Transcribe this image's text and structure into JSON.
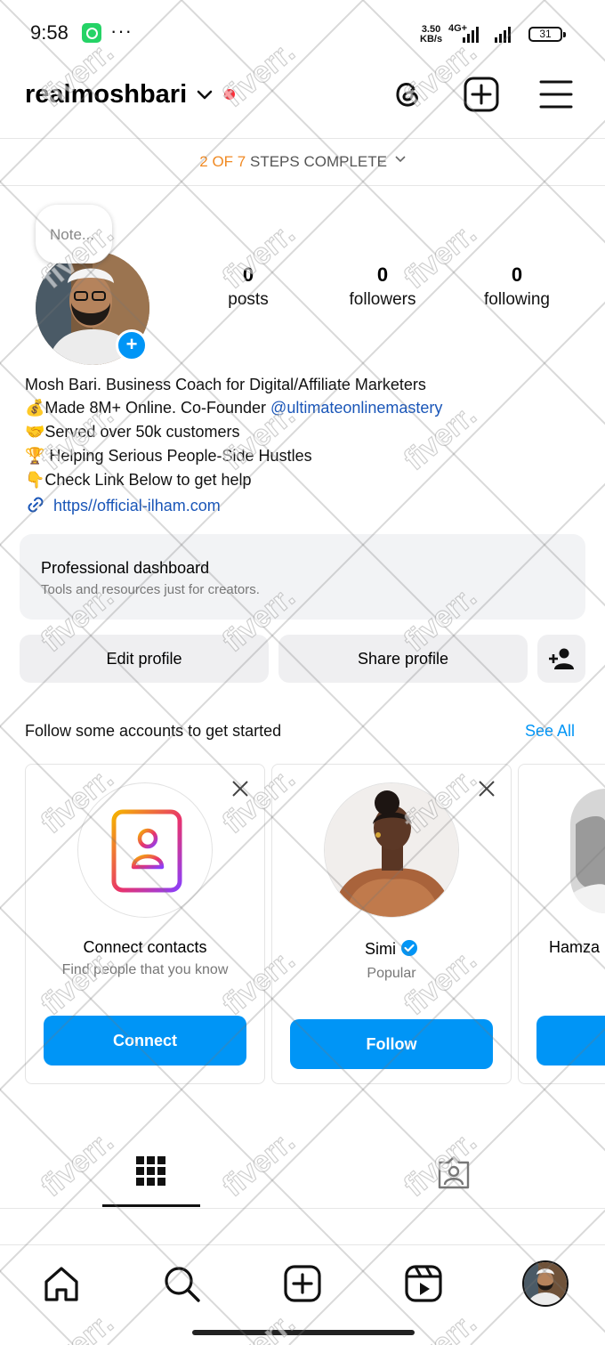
{
  "status_bar": {
    "time": "9:58",
    "more": "···",
    "speed_value": "3.50",
    "speed_unit": "KB/s",
    "network_type": "4G+",
    "battery": "31"
  },
  "header": {
    "username": "realmoshbari"
  },
  "onboarding": {
    "steps_done": "2 OF 7",
    "steps_text": "STEPS COMPLETE"
  },
  "profile": {
    "note_placeholder": "Note...",
    "posts_count": "0",
    "posts_label": "posts",
    "followers_count": "0",
    "followers_label": "followers",
    "following_count": "0",
    "following_label": "following"
  },
  "bio": {
    "line1": "Mosh Bari. Business Coach for Digital/Affiliate Marketers",
    "line2_prefix": "💰Made 8M+ Online. Co-Founder ",
    "line2_mention": "@ultimateonlinemastery",
    "line3": "🤝Served over 50k customers",
    "line4": "🏆 Helping Serious People-Side Hustles",
    "line5": "👇Check Link Below to get help",
    "link": "https//official-ilham.com"
  },
  "dashboard": {
    "title": "Professional dashboard",
    "subtitle": "Tools and resources just for creators."
  },
  "actions": {
    "edit_profile": "Edit profile",
    "share_profile": "Share profile"
  },
  "suggestions": {
    "title": "Follow some accounts to get started",
    "see_all": "See All",
    "cards": [
      {
        "name": "Connect contacts",
        "subtitle": "Find people that you know",
        "button": "Connect"
      },
      {
        "name": "Simi",
        "subtitle": "Popular",
        "button": "Follow"
      },
      {
        "name": "Hamza"
      }
    ]
  },
  "watermark": {
    "text": "fiverr."
  },
  "colors": {
    "accent_blue": "#0095f6",
    "link_blue": "#1a56b8",
    "steps_orange": "#f08a24",
    "notification_red": "#ff2d38",
    "panel_gray": "#f2f3f5"
  },
  "icons": {
    "header": [
      "threads-icon",
      "create-plus-icon",
      "menu-icon"
    ],
    "tabs": [
      "grid-icon",
      "tagged-icon"
    ],
    "bottom_nav": [
      "home-icon",
      "search-icon",
      "create-icon",
      "reels-icon",
      "profile-avatar"
    ]
  }
}
